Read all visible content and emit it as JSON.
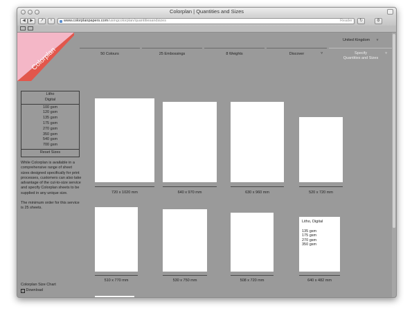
{
  "window": {
    "title": "Colorplan | Quantities and Sizes"
  },
  "browser": {
    "url_domain": "www.colorplanpapers.com",
    "url_path": "/usingcolorplan/quantitiesandsizes",
    "reader_label": "Reader"
  },
  "logo": {
    "text": "Colorplan",
    "triangle_color": "#f4b7c7",
    "stripe_color": "#e2574c"
  },
  "region": {
    "label": "United Kingdom"
  },
  "nav": {
    "items": [
      {
        "label": "50 Colours"
      },
      {
        "label": "25 Embossings"
      },
      {
        "label": "8 Weights"
      },
      {
        "label": "Discover"
      }
    ],
    "specify": {
      "line1": "Specify",
      "line2": "Quantities and Sizes"
    }
  },
  "filters": {
    "finishes": [
      "Litho",
      "Digital"
    ],
    "weights": [
      "100 gsm",
      "120 gsm",
      "135 gsm",
      "175 gsm",
      "270 gsm",
      "350 gsm",
      "540 gsm",
      "700 gsm"
    ],
    "reset_label": "Reset Sizes"
  },
  "info": {
    "paragraph1": "While Colorplan is available in a comprehensive range of sheet sizes designed specifically for print processes, customers can also take advantage of the cut-to-size service and specify Colorplan sheets to be supplied in any unique size.",
    "paragraph2": "The minimum order for this service is 25 sheets."
  },
  "sheets": [
    {
      "label": "720 x 1020 mm"
    },
    {
      "label": "640 x 970 mm"
    },
    {
      "label": "630 x 960 mm"
    },
    {
      "label": "520 x 720 mm"
    },
    {
      "label": "510 x 770 mm"
    },
    {
      "label": "530 x 750 mm"
    },
    {
      "label": "508 x 720 mm"
    },
    {
      "label": "640 x 482 mm"
    }
  ],
  "hover_sheet": {
    "finish": "Litho, Digital",
    "weights": [
      "135 gsm",
      "175 gsm",
      "270 gsm",
      "350 gsm"
    ]
  },
  "chart_link": {
    "label": "Colorplan Size Chart",
    "download_label": "Download"
  }
}
